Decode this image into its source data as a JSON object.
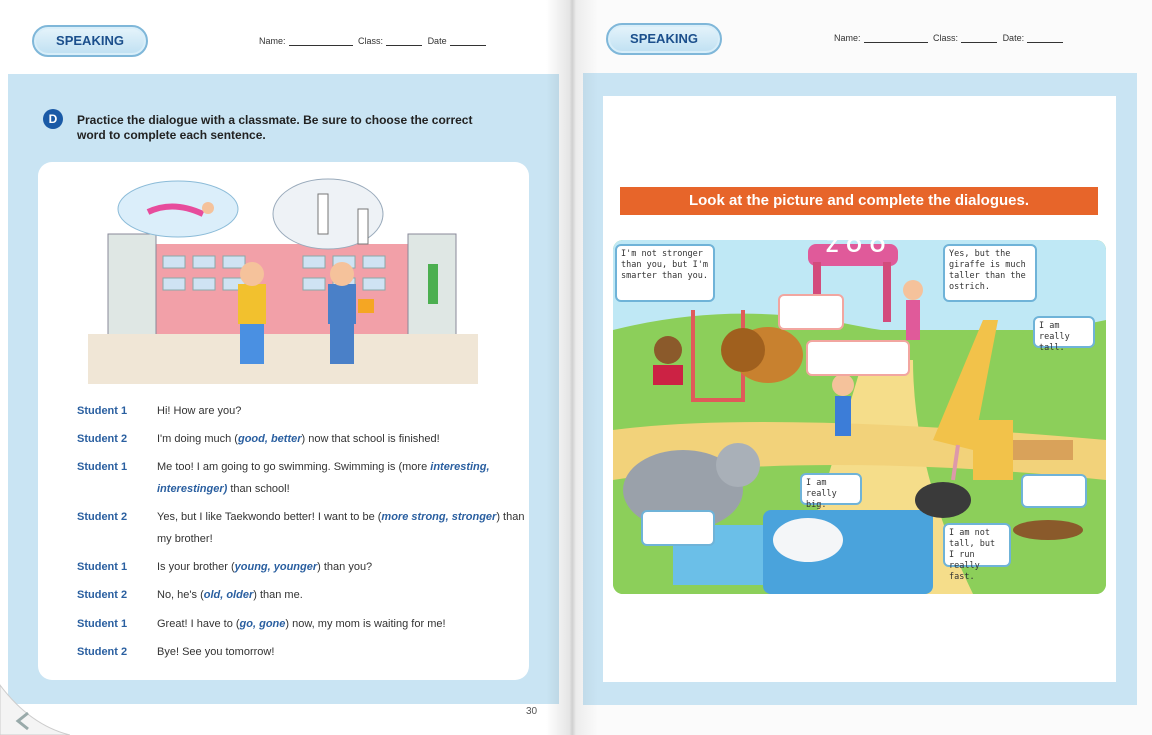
{
  "left": {
    "badge": "SPEAKING",
    "name_label": "Name:",
    "class_label": "Class:",
    "date_label": "Date",
    "activity_letter": "D",
    "instruction_line1": "Practice the dialogue with a classmate. Be sure to choose the correct",
    "instruction_line2": "word to complete each sentence.",
    "dialogue": [
      {
        "speaker": "Student 1",
        "pre": "Hi! How are you?",
        "opt": "",
        "post": ""
      },
      {
        "speaker": "Student 2",
        "pre": "I'm doing much (",
        "opt": "good, better",
        "post": ") now that school is finished!"
      },
      {
        "speaker": "Student 1",
        "pre": "Me too! I am going to go swimming. Swimming is (more ",
        "opt": "interesting, interestinger)",
        "post": " than school!"
      },
      {
        "speaker": "Student 2",
        "pre": "Yes, but I like Taekwondo better! I want to be (",
        "opt": "more strong, stronger",
        "post": ") than my brother!"
      },
      {
        "speaker": "Student 1",
        "pre": "Is your brother (",
        "opt": "young, younger",
        "post": ") than you?"
      },
      {
        "speaker": "Student 2",
        "pre": "No, he's (",
        "opt": "old, older",
        "post": ") than me."
      },
      {
        "speaker": "Student 1",
        "pre": "Great! I have to (",
        "opt": "go, gone",
        "post": ") now, my mom is waiting for me!"
      },
      {
        "speaker": "Student 2",
        "pre": "Bye!  See you tomorrow!",
        "opt": "",
        "post": ""
      }
    ],
    "page_number": "30"
  },
  "right": {
    "badge": "SPEAKING",
    "name_label": "Name:",
    "class_label": "Class:",
    "date_label": "Date:",
    "banner": "Look at the picture and complete the dialogues.",
    "zoo_sign": "ZOO",
    "bubbles": {
      "monkey": "I'm not stronger than you, but I'm smarter than you.",
      "girl": "Yes, but the giraffe is much taller than the ostrich.",
      "giraffe": "I am really tall.",
      "elephant": "I am really big.",
      "ostrich": "I am not tall, but I run really fast."
    }
  },
  "colors": {
    "panel_blue": "#c9e4f3",
    "badge_text": "#1b4f8c",
    "option_blue": "#2a5fa0",
    "banner_orange": "#e7652a"
  }
}
